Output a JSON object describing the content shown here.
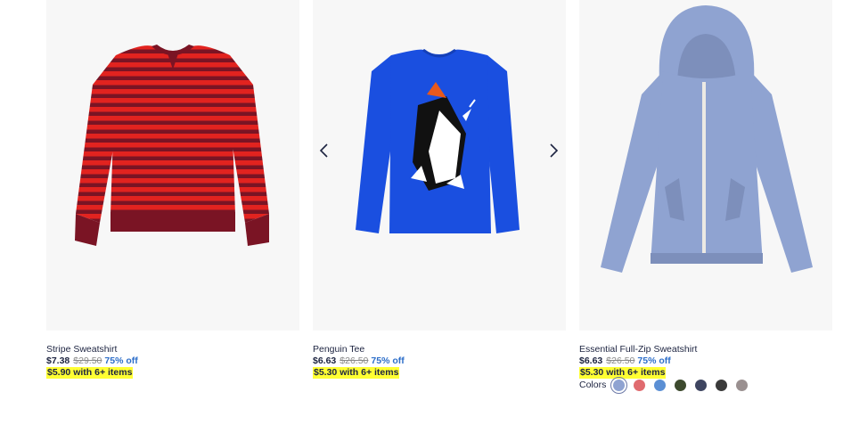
{
  "products": [
    {
      "name": "Stripe Sweatshirt",
      "price": "$7.38",
      "original_price": "$29.50",
      "discount": "75% off",
      "promo": "$5.90 with 6+ items"
    },
    {
      "name": "Penguin Tee",
      "price": "$6.63",
      "original_price": "$26.50",
      "discount": "75% off",
      "promo": "$5.30 with 6+ items"
    },
    {
      "name": "Essential Full-Zip Sweatshirt",
      "price": "$6.63",
      "original_price": "$26.50",
      "discount": "75% off",
      "promo": "$5.30 with 6+ items",
      "colors_label": "Colors",
      "swatches": [
        "#8fa3d1",
        "#e06b6f",
        "#5b8fd4",
        "#3d4a2e",
        "#3e4560",
        "#3a3a3a",
        "#9a9090"
      ]
    }
  ],
  "colors": {
    "link": "#1c2340",
    "discount": "#2d6ec9",
    "promo_highlight": "#ffff33",
    "image_bg": "#f7f7f7"
  },
  "icons": {
    "prev": "chevron-left-icon",
    "next": "chevron-right-icon"
  }
}
